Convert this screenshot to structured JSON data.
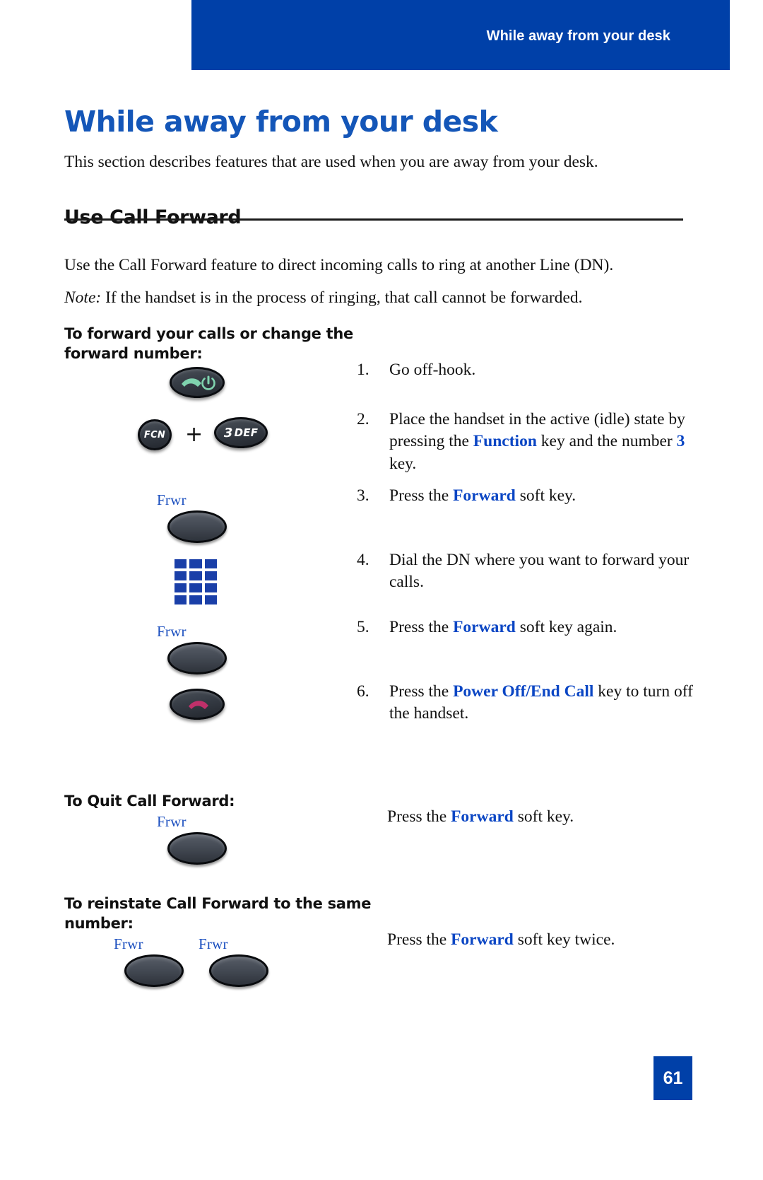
{
  "running_header": {
    "text": "While away from your desk"
  },
  "page": {
    "chapter_title": "While away from your desk",
    "intro": "This section describes features that are used when you are away from your desk.",
    "section": {
      "heading": "Use Call Forward",
      "paragraph": "Use the Call Forward feature to direct incoming calls to ring at another Line (DN).",
      "note_label": "Note:",
      "note_text": " If the handset is in the process of ringing, that call cannot be forwarded."
    },
    "sub_headings": {
      "forward_calls": "To forward your calls or change the forward number:",
      "quit": "To Quit Call Forward:",
      "reinstate": "To reinstate Call Forward to the same number:"
    },
    "steps": [
      {
        "num": "1.",
        "parts": [
          {
            "text": "Go off-hook."
          }
        ]
      },
      {
        "num": "2.",
        "parts": [
          {
            "text": "Place the handset in the active (idle) state by pressing the "
          },
          {
            "text": "Function",
            "style": "blue-bold"
          },
          {
            "text": " key and the number "
          },
          {
            "text": "3",
            "style": "blue-bold"
          },
          {
            "text": " key."
          }
        ]
      },
      {
        "num": "3.",
        "parts": [
          {
            "text": "Press the "
          },
          {
            "text": "Forward",
            "style": "blue-bold"
          },
          {
            "text": " soft key."
          }
        ]
      },
      {
        "num": "4.",
        "parts": [
          {
            "text": "Dial the DN where you want to forward your calls."
          }
        ]
      },
      {
        "num": "5.",
        "parts": [
          {
            "text": "Press the "
          },
          {
            "text": "Forward",
            "style": "blue-bold"
          },
          {
            "text": " soft key again."
          }
        ]
      },
      {
        "num": "6.",
        "parts": [
          {
            "text": "Press the "
          },
          {
            "text": "Power Off/End Call",
            "style": "blue-bold"
          },
          {
            "text": " key to turn off the handset."
          }
        ]
      }
    ],
    "plain_steps": {
      "quit": [
        {
          "text": "Press the "
        },
        {
          "text": "Forward",
          "style": "blue-bold"
        },
        {
          "text": " soft key."
        }
      ],
      "reinstate": [
        {
          "text": "Press the "
        },
        {
          "text": "Forward",
          "style": "blue-bold"
        },
        {
          "text": " soft key twice."
        }
      ]
    },
    "key_art": {
      "offhook_key_name": "off-hook-key",
      "fcn_key_label": "FCN",
      "plus": "+",
      "def_key_number": "3",
      "def_key_letters": "DEF",
      "softkey_labels": {
        "step3": "Frwr",
        "step5": "Frwr",
        "quit": "Frwr",
        "reinstate_first": "Frwr",
        "reinstate_second": "Frwr"
      }
    },
    "page_number": "61"
  },
  "colors": {
    "header_blue": "#0040A8",
    "title_blue": "#1456B8",
    "emphasis_blue": "#0B46C4",
    "softkey_label_blue": "#1B4FBF",
    "keypad_blue": "#1A3FA8"
  }
}
